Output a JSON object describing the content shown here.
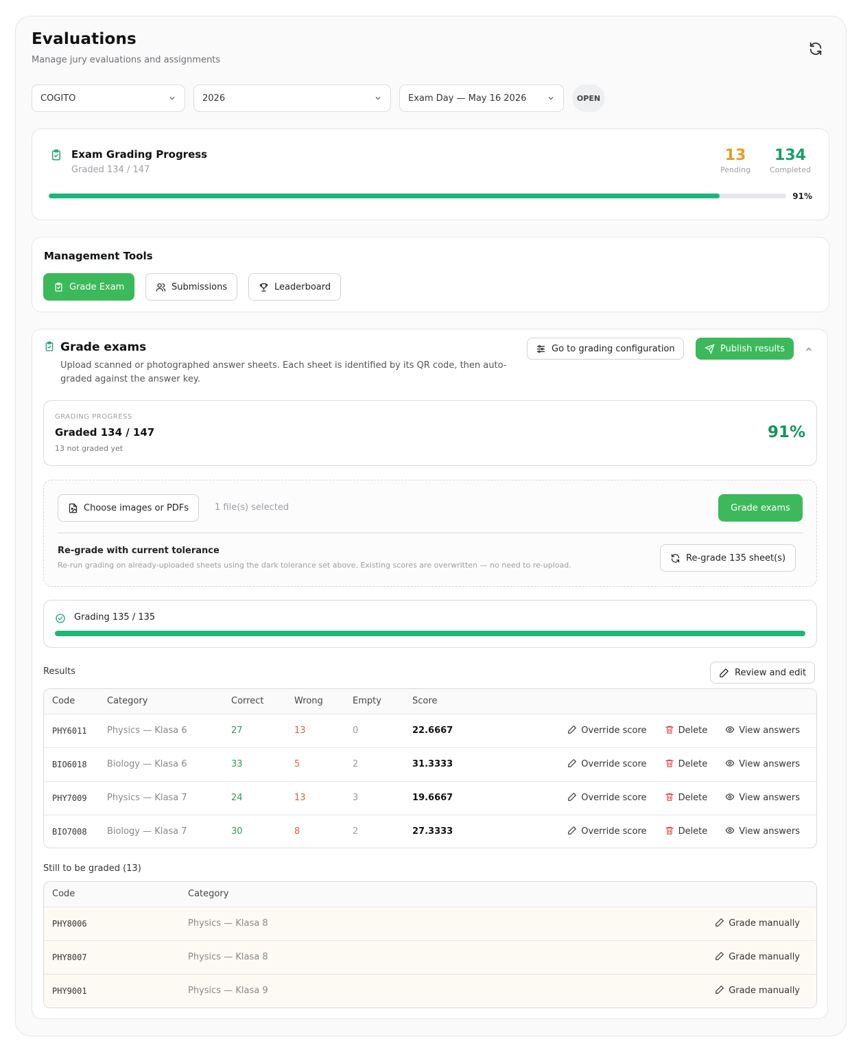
{
  "header": {
    "title": "Evaluations",
    "subtitle": "Manage jury evaluations and assignments"
  },
  "filters": {
    "organization": "COGITO",
    "year": "2026",
    "session": "Exam Day — May 16 2026",
    "status_badge": "OPEN"
  },
  "progress": {
    "title": "Exam Grading Progress",
    "graded_text": "Graded 134 / 147",
    "pending_count": "13",
    "pending_label": "Pending",
    "completed_count": "134",
    "completed_label": "Completed",
    "percent_text": "91%",
    "fraction": 0.91
  },
  "tools": {
    "title": "Management Tools",
    "grade_exam": "Grade Exam",
    "submissions": "Submissions",
    "leaderboard": "Leaderboard"
  },
  "grade_exams": {
    "title": "Grade exams",
    "description": "Upload scanned or photographed answer sheets. Each sheet is identified by its QR code, then auto-graded against the answer key.",
    "config_button": "Go to grading configuration",
    "publish_button": "Publish results",
    "grading_progress": {
      "label": "GRADING PROGRESS",
      "main": "Graded 134 / 147",
      "sub": "13 not graded yet",
      "percent": "91%"
    },
    "upload": {
      "choose_button": "Choose images or PDFs",
      "selected_text": "1 file(s) selected",
      "grade_button": "Grade exams",
      "regrade_title": "Re-grade with current tolerance",
      "regrade_desc": "Re-run grading on already-uploaded sheets using the dark tolerance set above. Existing scores are overwritten — no need to re-upload.",
      "regrade_button": "Re-grade 135 sheet(s)"
    },
    "run": {
      "text": "Grading 135 / 135",
      "fraction": 1.0
    },
    "results_label": "Results",
    "review_button": "Review and edit",
    "results_headers": [
      "Code",
      "Category",
      "Correct",
      "Wrong",
      "Empty",
      "Score"
    ],
    "results": [
      {
        "code": "PHY6011",
        "category": "Physics — Klasa 6",
        "correct": "27",
        "wrong": "13",
        "empty": "0",
        "score": "22.6667"
      },
      {
        "code": "BIO6018",
        "category": "Biology — Klasa 6",
        "correct": "33",
        "wrong": "5",
        "empty": "2",
        "score": "31.3333"
      },
      {
        "code": "PHY7009",
        "category": "Physics — Klasa 7",
        "correct": "24",
        "wrong": "13",
        "empty": "3",
        "score": "19.6667"
      },
      {
        "code": "BIO7008",
        "category": "Biology — Klasa 7",
        "correct": "30",
        "wrong": "8",
        "empty": "2",
        "score": "27.3333"
      }
    ],
    "row_actions": {
      "override": "Override score",
      "delete": "Delete",
      "view": "View answers"
    },
    "still_label": "Still to be graded (13)",
    "still_headers": [
      "Code",
      "Category"
    ],
    "still": [
      {
        "code": "PHY8006",
        "category": "Physics — Klasa 8"
      },
      {
        "code": "PHY8007",
        "category": "Physics — Klasa 8"
      },
      {
        "code": "PHY9001",
        "category": "Physics — Klasa 9"
      }
    ],
    "grade_manually": "Grade manually"
  },
  "colors": {
    "accent_green": "#3cb95a",
    "progress_green": "#19b778",
    "pending_orange": "#eb9a1f",
    "completed_teal": "#16a06a",
    "wrong_red": "#d8603f",
    "delete_red": "#e04848"
  }
}
